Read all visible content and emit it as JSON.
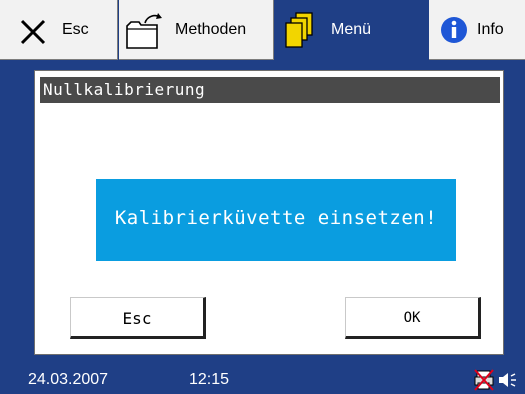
{
  "tabs": [
    {
      "label": "Esc",
      "icon": "close-x-icon"
    },
    {
      "label": "Methoden",
      "icon": "folder-arrow-icon"
    },
    {
      "label": "Menü",
      "icon": "stacked-pages-icon",
      "active": true
    },
    {
      "label": "Info",
      "icon": "info-circle-icon"
    }
  ],
  "dialog": {
    "title": "Nullkalibrierung",
    "message": "Kalibrierküvette einsetzen!",
    "esc_label": "Esc",
    "ok_label": "OK"
  },
  "status": {
    "date": "24.03.2007",
    "time": "12:15",
    "icons": [
      "printer-crossed-icon",
      "speaker-icon"
    ]
  },
  "colors": {
    "frame": "#1f3f86",
    "message_bg": "#0a9de0",
    "title_bg": "#4a4a4a",
    "info_icon": "#1f57d6",
    "menu_icon": "#f2d500",
    "crossed_icon": "#e0001a"
  }
}
